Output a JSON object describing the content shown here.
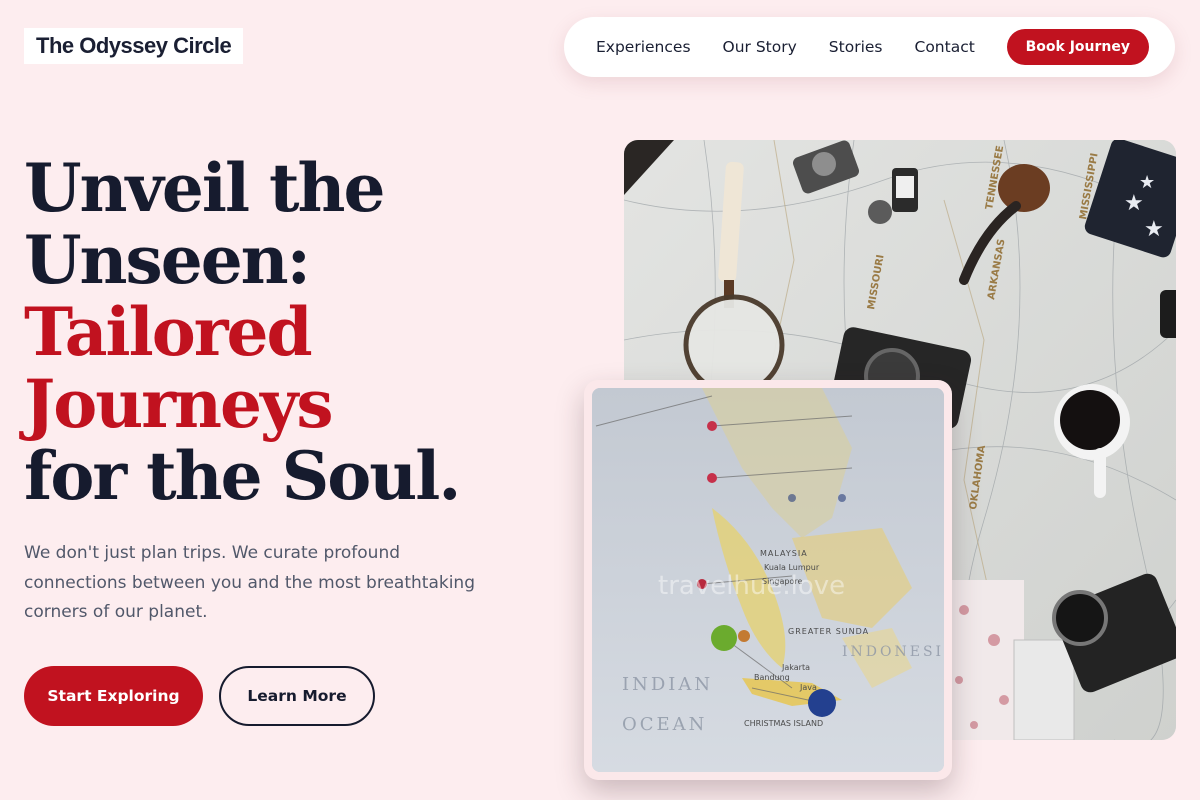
{
  "brand": {
    "name": "The Odyssey Circle"
  },
  "nav": {
    "links": [
      "Experiences",
      "Our Story",
      "Stories",
      "Contact"
    ],
    "cta": "Book Journey"
  },
  "hero": {
    "title_lines": [
      "Unveil the",
      "Unseen:"
    ],
    "title_accent_lines": [
      "Tailored",
      "Journeys"
    ],
    "title_end": "for the Soul.",
    "subtitle": "We don't just plan trips. We curate profound connections between you and the most breathtaking corners of our planet.",
    "primary_button": "Start Exploring",
    "secondary_button": "Learn More"
  },
  "images": {
    "main_map_labels": [
      "MISSOURI",
      "ARKANSAS",
      "OKLAHOMA",
      "MISSISSIPPI",
      "TENNESSEE"
    ],
    "card_map_labels": [
      "MALAYSIA",
      "Kuala Lumpur",
      "Singapore",
      "Jakarta",
      "Bandung",
      "Java",
      "INDIAN",
      "OCEAN",
      "INDONESIA",
      "GREATER SUNDA",
      "CHRISTMAS ISLAND"
    ],
    "watermark": "travelhue.love"
  },
  "colors": {
    "background": "#fdedef",
    "accent": "#c1121f",
    "text_dark": "#161b2e",
    "text_muted": "#51586a"
  }
}
